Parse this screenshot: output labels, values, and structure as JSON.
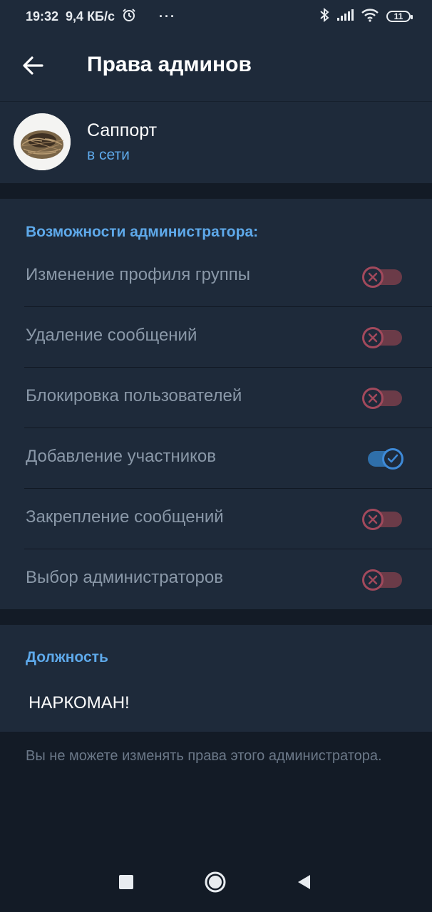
{
  "status_bar": {
    "time": "19:32",
    "speed": "9,4 КБ/с",
    "dots": "···",
    "battery": "11"
  },
  "header": {
    "title": "Права админов"
  },
  "profile": {
    "name": "Саппорт",
    "status": "в сети"
  },
  "permissions": {
    "header": "Возможности администратора:",
    "items": [
      {
        "label": "Изменение профиля группы",
        "enabled": false
      },
      {
        "label": "Удаление сообщений",
        "enabled": false
      },
      {
        "label": "Блокировка пользователей",
        "enabled": false
      },
      {
        "label": "Добавление участников",
        "enabled": true
      },
      {
        "label": "Закрепление сообщений",
        "enabled": false
      },
      {
        "label": "Выбор администраторов",
        "enabled": false
      }
    ]
  },
  "rank": {
    "header": "Должность",
    "value": "НАРКОМАН!"
  },
  "notice": "Вы не можете изменять права этого администратора.",
  "colors": {
    "accent": "#5ea9ea",
    "toggle_on": "#3e8ad8",
    "toggle_off": "#a2495c",
    "background": "#131b26",
    "surface": "#1e2a3a"
  },
  "icons": {
    "back": "arrow-left-icon",
    "alarm": "alarm-clock-icon",
    "bluetooth": "bluetooth-icon",
    "signal": "signal-icon",
    "wifi": "wifi-icon",
    "nav_recent": "square-icon",
    "nav_home": "circle-icon",
    "nav_back": "triangle-icon"
  }
}
